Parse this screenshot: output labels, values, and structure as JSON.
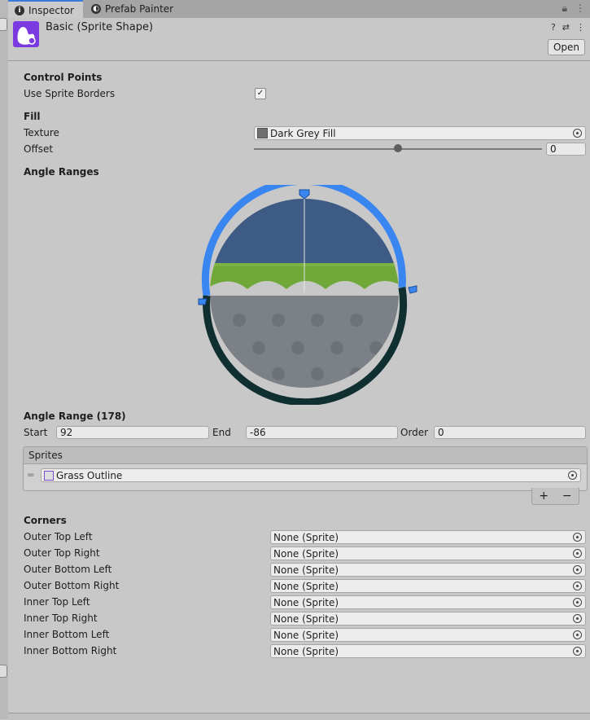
{
  "tabs": [
    {
      "label": "Inspector"
    },
    {
      "label": "Prefab Painter"
    }
  ],
  "header": {
    "title": "Basic (Sprite Shape)",
    "open_label": "Open"
  },
  "control_points": {
    "section": "Control Points",
    "use_sprite_borders_label": "Use Sprite Borders",
    "use_sprite_borders_checked": true,
    "check_glyph": "✓"
  },
  "fill": {
    "section": "Fill",
    "texture_label": "Texture",
    "texture_value": "Dark Grey Fill",
    "offset_label": "Offset",
    "offset_value": "0",
    "offset_slider_fraction": 0.5
  },
  "angle_ranges": {
    "section": "Angle Ranges",
    "range_title": "Angle Range (178)",
    "start_label": "Start",
    "start_value": "92",
    "end_label": "End",
    "end_value": "-86",
    "order_label": "Order",
    "order_value": "0",
    "sprites_header": "Sprites",
    "sprites": [
      "Grass Outline"
    ],
    "add_label": "+",
    "remove_label": "−"
  },
  "corners": {
    "section": "Corners",
    "items": [
      {
        "label": "Outer Top Left",
        "value": "None (Sprite)"
      },
      {
        "label": "Outer Top Right",
        "value": "None (Sprite)"
      },
      {
        "label": "Outer Bottom Left",
        "value": "None (Sprite)"
      },
      {
        "label": "Outer Bottom Right",
        "value": "None (Sprite)"
      },
      {
        "label": "Inner Top Left",
        "value": "None (Sprite)"
      },
      {
        "label": "Inner Top Right",
        "value": "None (Sprite)"
      },
      {
        "label": "Inner Bottom Left",
        "value": "None (Sprite)"
      },
      {
        "label": "Inner Bottom Right",
        "value": "None (Sprite)"
      }
    ]
  },
  "colors": {
    "accent": "#3a79d8",
    "range_arc": "#3a86f0",
    "dark_arc": "#0f2f30",
    "sky": "#3e5b86",
    "grass": "#7cb342",
    "fill_grey": "#7b8187"
  }
}
